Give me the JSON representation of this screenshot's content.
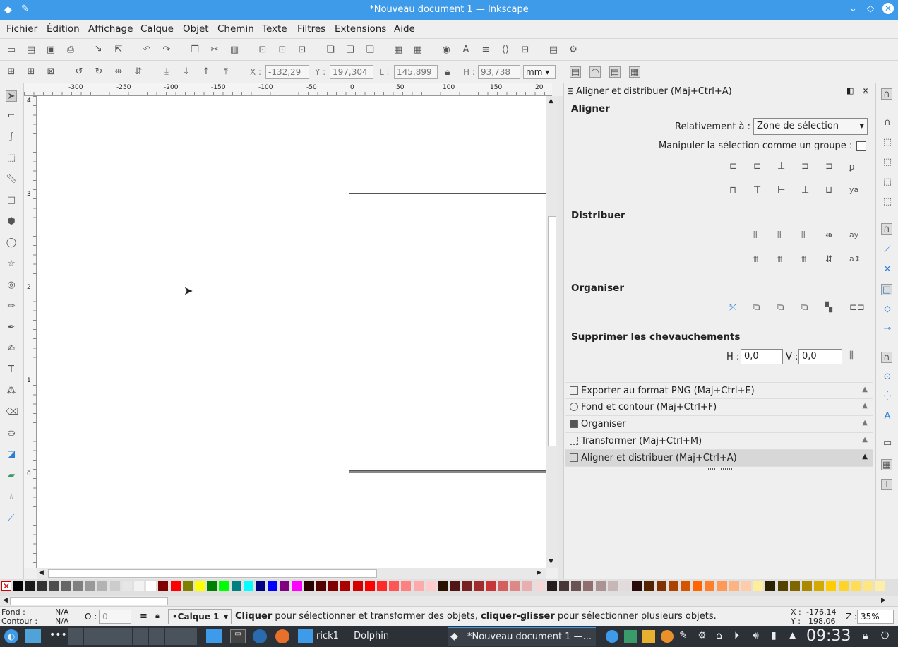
{
  "window": {
    "title": "*Nouveau document 1 — Inkscape"
  },
  "menu": [
    "Fichier",
    "Édition",
    "Affichage",
    "Calque",
    "Objet",
    "Chemin",
    "Texte",
    "Filtres",
    "Extensions",
    "Aide"
  ],
  "toolctrl": {
    "x_label": "X :",
    "x": "-132,29",
    "y_label": "Y :",
    "y": "197,304",
    "w_label": "L :",
    "w": "145,899",
    "h_label": "H :",
    "h": "93,738",
    "unit": "mm"
  },
  "ruler": {
    "h_ticks": [
      "-300",
      "-250",
      "-200",
      "-150",
      "-100",
      "-50",
      "0",
      "50",
      "100",
      "150",
      "20"
    ],
    "v_ticks": [
      "4",
      "3",
      "2",
      "1",
      "0"
    ]
  },
  "dock": {
    "title": "Aligner et distribuer (Maj+Ctrl+A)",
    "align_title": "Aligner",
    "relative_label": "Relativement à :",
    "relative_value": "Zone de sélection",
    "group_label": "Manipuler la sélection comme un groupe :",
    "distribute_title": "Distribuer",
    "arrange_title": "Organiser",
    "overlap_title": "Supprimer les chevauchements",
    "h_label": "H :",
    "h_value": "0,0",
    "v_label": "V :",
    "v_value": "0,0",
    "panels": [
      {
        "label": "Exporter au format PNG (Maj+Ctrl+E)"
      },
      {
        "label": "Fond et contour (Maj+Ctrl+F)"
      },
      {
        "label": "Organiser"
      },
      {
        "label": "Transformer (Maj+Ctrl+M)"
      },
      {
        "label": "Aligner et distribuer (Maj+Ctrl+A)"
      }
    ]
  },
  "status": {
    "fill_label": "Fond :",
    "fill_value": "N/A",
    "stroke_label": "Contour :",
    "stroke_value": "N/A",
    "opacity_label": "O :",
    "opacity_value": "0",
    "layer": "•Calque 1",
    "msg_b1": "Cliquer",
    "msg_1": " pour sélectionner et transformer des objets, ",
    "msg_b2": "cliquer-glisser",
    "msg_2": " pour sélectionner plusieurs objets.",
    "cx_label": "X :",
    "cx": "-176,14",
    "cy_label": "Y :",
    "cy": "198,06",
    "zoom_label": "Z :",
    "zoom": "35%"
  },
  "taskbar": {
    "dolphin": "rick1 — Dolphin",
    "inkscape": "*Nouveau document 1 —...",
    "clock": "09:33"
  },
  "colors": {
    "titlebar": "#3d9be9",
    "accent": "#3d9be9"
  }
}
